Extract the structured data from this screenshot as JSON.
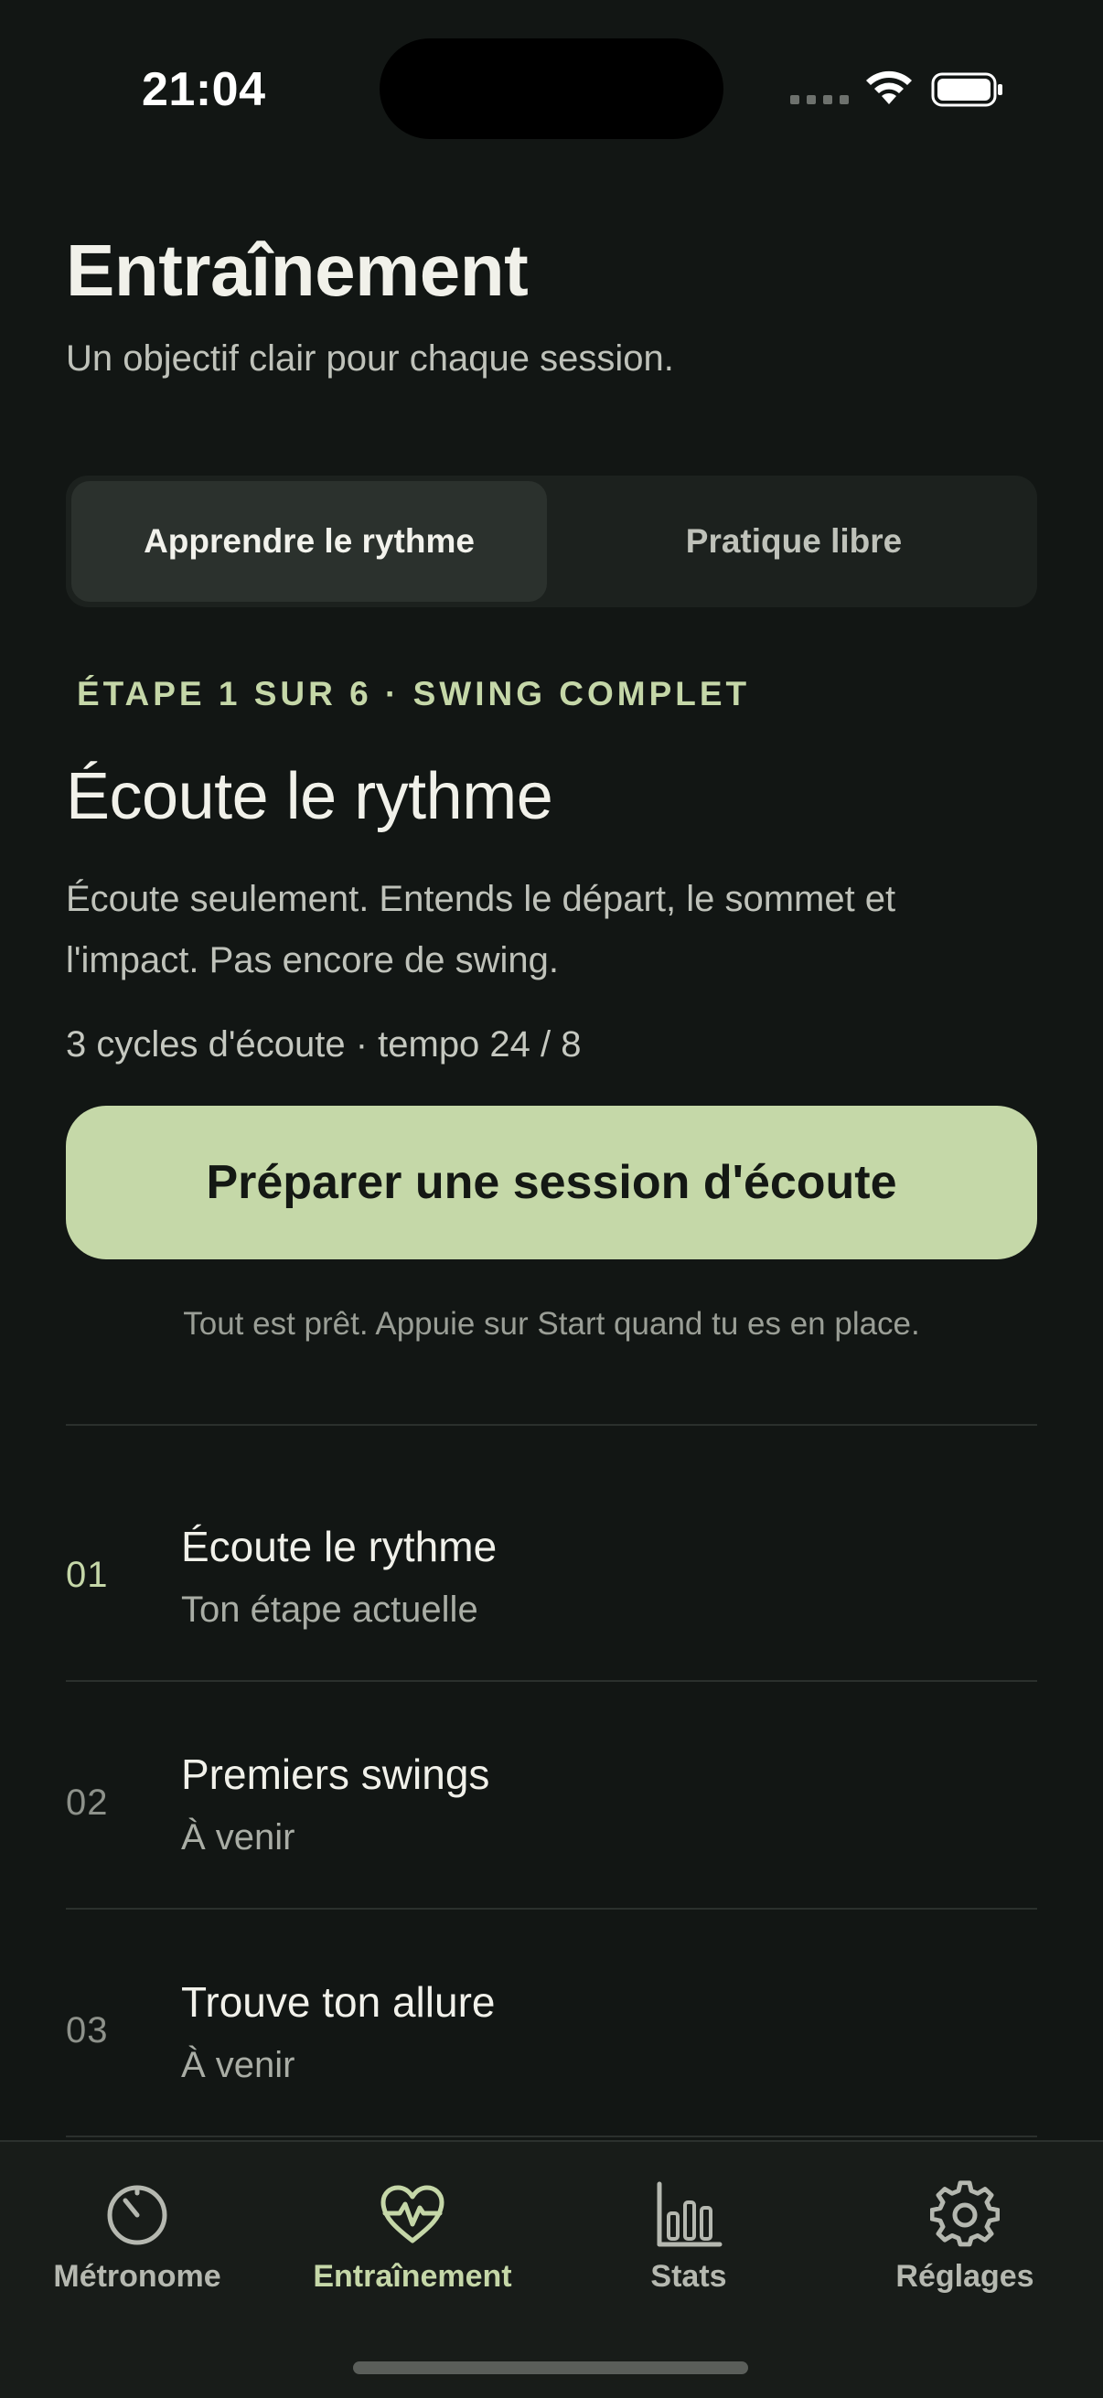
{
  "status_bar": {
    "time": "21:04"
  },
  "header": {
    "title": "Entraînement",
    "subtitle": "Un objectif clair pour chaque session."
  },
  "segmented": {
    "options": [
      "Apprendre le rythme",
      "Pratique libre"
    ],
    "selected": "Apprendre le rythme"
  },
  "current_step": {
    "eyebrow": "ÉTAPE 1 SUR 6 · SWING COMPLET",
    "title": "Écoute le rythme",
    "description": "Écoute seulement. Entends le départ, le sommet et l'impact. Pas encore de swing.",
    "meta": "3 cycles d'écoute · tempo 24 / 8",
    "button_label": "Préparer une session d'écoute",
    "hint": "Tout est prêt. Appuie sur Start quand tu es en place."
  },
  "steps": [
    {
      "number": "01",
      "name": "Écoute le rythme",
      "status": "Ton étape actuelle"
    },
    {
      "number": "02",
      "name": "Premiers swings",
      "status": "À venir"
    },
    {
      "number": "03",
      "name": "Trouve ton allure",
      "status": "À venir"
    }
  ],
  "tabbar": {
    "items": [
      {
        "label": "Métronome",
        "icon": "metronome-gauge-icon"
      },
      {
        "label": "Entraînement",
        "icon": "heart-pulse-icon"
      },
      {
        "label": "Stats",
        "icon": "bar-chart-icon"
      },
      {
        "label": "Réglages",
        "icon": "gear-icon"
      }
    ],
    "active": "Entraînement"
  },
  "colors": {
    "background": "#121614",
    "accent": "#C5D8A8",
    "text_primary": "#F1F1EA",
    "text_secondary": "#BFC2BA",
    "tab_inactive": "#B5B8B0"
  }
}
